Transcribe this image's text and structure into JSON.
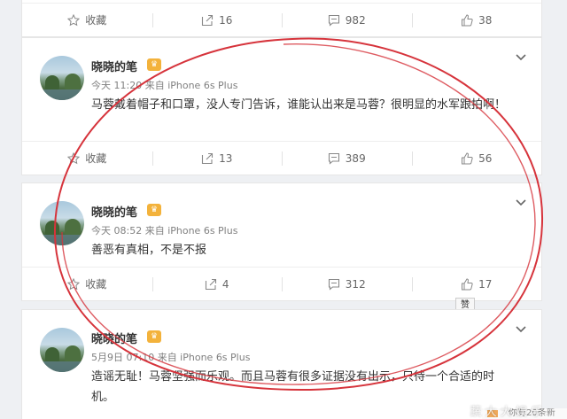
{
  "first_card": {
    "actions": [
      {
        "icon": "star-icon",
        "label": "收藏"
      },
      {
        "icon": "share-icon",
        "label": "16"
      },
      {
        "icon": "comment-icon",
        "label": "982"
      },
      {
        "icon": "like-icon",
        "label": "38"
      }
    ]
  },
  "posts": [
    {
      "user": "晓晓的笔",
      "meta": "今天 11:20 来自 iPhone 6s Plus",
      "text": "马蓉戴着帽子和口罩，没人专门告诉，谁能认出来是马蓉？很明显的水军跟拍啊！",
      "actions": [
        {
          "icon": "star-icon",
          "label": "收藏"
        },
        {
          "icon": "share-icon",
          "label": "13"
        },
        {
          "icon": "comment-icon",
          "label": "389"
        },
        {
          "icon": "like-icon",
          "label": "56"
        }
      ]
    },
    {
      "user": "晓晓的笔",
      "meta": "今天 08:52 来自 iPhone 6s Plus",
      "text": "善恶有真相，不是不报",
      "actions": [
        {
          "icon": "star-icon",
          "label": "收藏"
        },
        {
          "icon": "share-icon",
          "label": "4"
        },
        {
          "icon": "comment-icon",
          "label": "312"
        },
        {
          "icon": "like-icon",
          "label": "17"
        }
      ]
    },
    {
      "user": "晓晓的笔",
      "meta": "5月9日 07:10 来自 iPhone 6s Plus",
      "text": "造谣无耻！马蓉坚强而乐观。而且马蓉有很多证据没有出示，只待一个合适的时机。"
    }
  ],
  "tooltip": "赞",
  "watermark": "蔬 大 大 娱 乐",
  "message_bar": "你有20条新",
  "colors": {
    "annotation": "#d6333b",
    "vip_badge": "#f3b23b"
  }
}
